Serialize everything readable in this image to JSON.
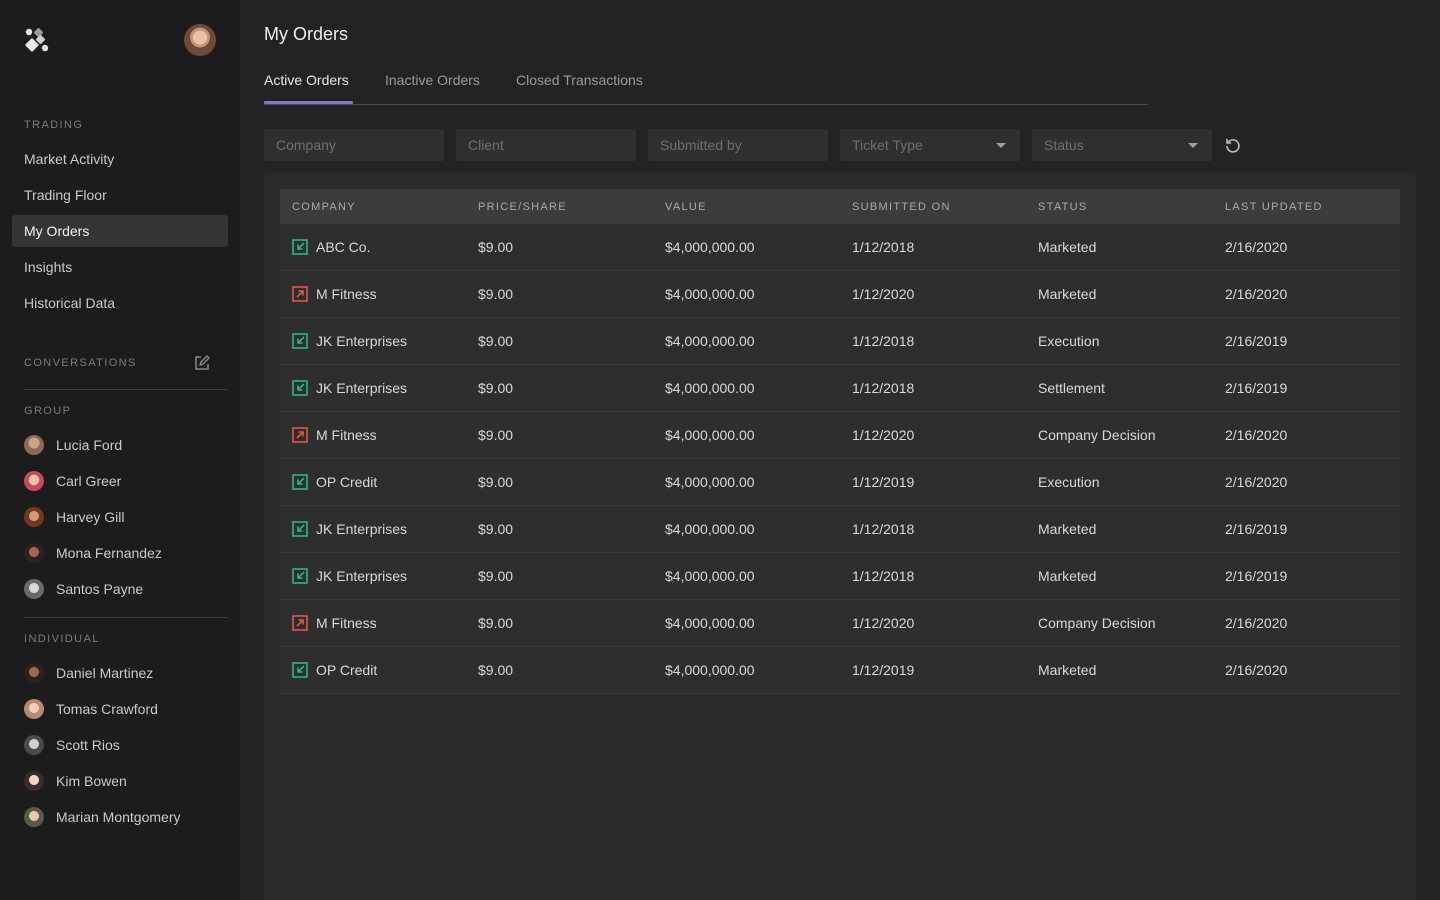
{
  "page_title": "My Orders",
  "sidebar": {
    "trading_label": "TRADING",
    "nav": [
      "Market Activity",
      "Trading Floor",
      "My Orders",
      "Insights",
      "Historical Data"
    ],
    "active_nav": "My Orders",
    "conversations_label": "CONVERSATIONS",
    "group_label": "GROUP",
    "group": [
      "Lucia Ford",
      "Carl Greer",
      "Harvey Gill",
      "Mona Fernandez",
      "Santos Payne"
    ],
    "individual_label": "INDIVIDUAL",
    "individual": [
      "Daniel Martinez",
      "Tomas Crawford",
      "Scott Rios",
      "Kim Bowen",
      "Marian Montgomery"
    ]
  },
  "tabs": [
    "Active Orders",
    "Inactive Orders",
    "Closed Transactions"
  ],
  "active_tab": "Active Orders",
  "filters": {
    "company": "Company",
    "client": "Client",
    "submitted_by": "Submitted by",
    "ticket_type": "Ticket Type",
    "status": "Status"
  },
  "table": {
    "headers": [
      "COMPANY",
      "PRICE/SHARE",
      "VALUE",
      "SUBMITTED ON",
      "STATUS",
      "LAST UPDATED"
    ],
    "rows": [
      {
        "type": "buy",
        "company": "ABC Co.",
        "price": "$9.00",
        "value": "$4,000,000.00",
        "submitted": "1/12/2018",
        "status": "Marketed",
        "updated": "2/16/2020"
      },
      {
        "type": "sell",
        "company": "M Fitness",
        "price": "$9.00",
        "value": "$4,000,000.00",
        "submitted": "1/12/2020",
        "status": "Marketed",
        "updated": "2/16/2020"
      },
      {
        "type": "buy",
        "company": "JK Enterprises",
        "price": "$9.00",
        "value": "$4,000,000.00",
        "submitted": "1/12/2018",
        "status": "Execution",
        "updated": "2/16/2019"
      },
      {
        "type": "buy",
        "company": "JK Enterprises",
        "price": "$9.00",
        "value": "$4,000,000.00",
        "submitted": "1/12/2018",
        "status": "Settlement",
        "updated": "2/16/2019"
      },
      {
        "type": "sell",
        "company": "M Fitness",
        "price": "$9.00",
        "value": "$4,000,000.00",
        "submitted": "1/12/2020",
        "status": "Company Decision",
        "updated": "2/16/2020"
      },
      {
        "type": "buy",
        "company": "OP Credit",
        "price": "$9.00",
        "value": "$4,000,000.00",
        "submitted": "1/12/2019",
        "status": "Execution",
        "updated": "2/16/2020"
      },
      {
        "type": "buy",
        "company": "JK Enterprises",
        "price": "$9.00",
        "value": "$4,000,000.00",
        "submitted": "1/12/2018",
        "status": "Marketed",
        "updated": "2/16/2019"
      },
      {
        "type": "buy",
        "company": "JK Enterprises",
        "price": "$9.00",
        "value": "$4,000,000.00",
        "submitted": "1/12/2018",
        "status": "Marketed",
        "updated": "2/16/2019"
      },
      {
        "type": "sell",
        "company": "M Fitness",
        "price": "$9.00",
        "value": "$4,000,000.00",
        "submitted": "1/12/2020",
        "status": "Company Decision",
        "updated": "2/16/2020"
      },
      {
        "type": "buy",
        "company": "OP Credit",
        "price": "$9.00",
        "value": "$4,000,000.00",
        "submitted": "1/12/2019",
        "status": "Marketed",
        "updated": "2/16/2020"
      }
    ]
  },
  "colors": {
    "accent": "#7f7ad1",
    "buy_icon": "#2bb58a",
    "sell_icon": "#e0584a",
    "background": "#232323",
    "sidebar": "#1c1c1c"
  },
  "icons": {
    "logo": "app-logo-icon",
    "compose": "compose-icon",
    "reset": "reset-icon",
    "buy": "arrow-in-icon",
    "sell": "arrow-out-icon"
  }
}
